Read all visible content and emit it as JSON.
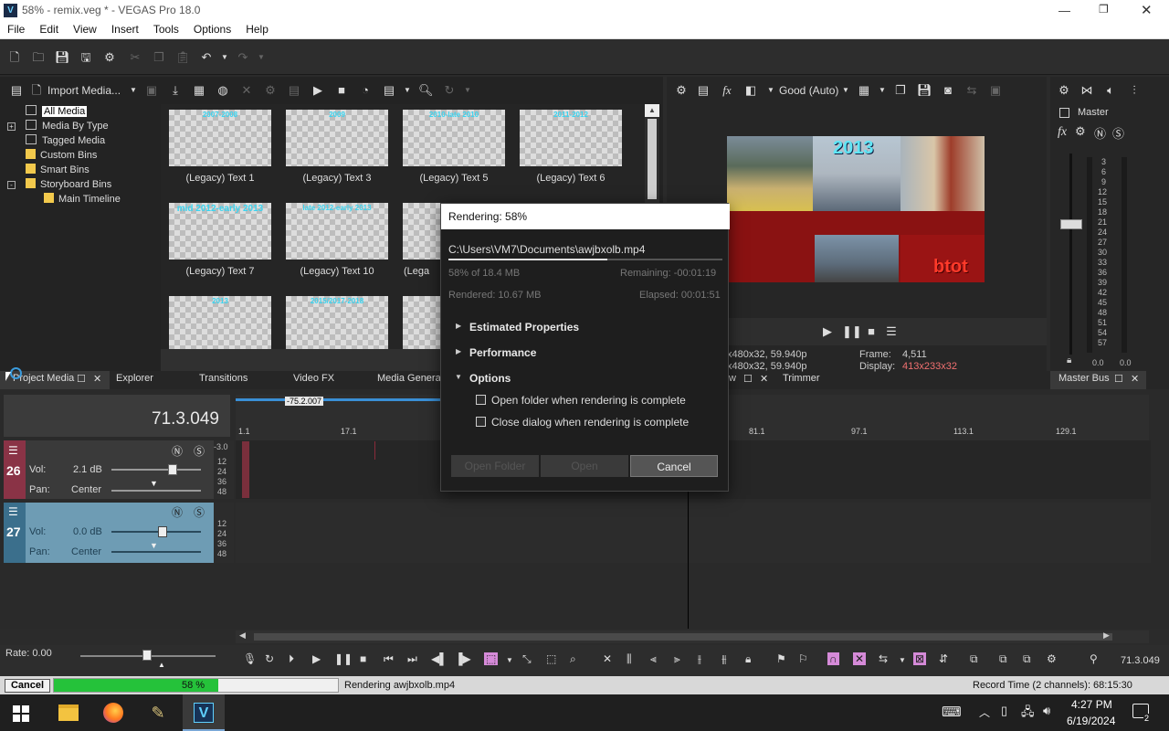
{
  "window": {
    "title": "58% - remix.veg * - VEGAS Pro 18.0"
  },
  "menu": [
    "File",
    "Edit",
    "View",
    "Insert",
    "Tools",
    "Options",
    "Help"
  ],
  "explorer": {
    "import_label": "Import Media...",
    "tree": [
      "All Media",
      "Media By Type",
      "Tagged Media",
      "Custom Bins",
      "Smart Bins",
      "Storyboard Bins",
      "Main Timeline"
    ],
    "thumbs": [
      {
        "overlay": "2007-2008",
        "caption": "(Legacy) Text 1"
      },
      {
        "overlay": "2009",
        "caption": "(Legacy) Text 3"
      },
      {
        "overlay": "2010-late 2010",
        "caption": "(Legacy) Text 5"
      },
      {
        "overlay": "2011-2012",
        "caption": "(Legacy) Text 6"
      },
      {
        "overlay": "mid 2012-early 2013",
        "caption": "(Legacy) Text 7"
      },
      {
        "overlay": "late 2012-early 2013",
        "caption": "(Legacy) Text 10"
      },
      {
        "overlay": "",
        "caption": "(Lega"
      },
      {
        "overlay": "2013",
        "caption": ""
      },
      {
        "overlay": "2015/2017-2018",
        "caption": ""
      },
      {
        "overlay": "",
        "caption": ""
      }
    ]
  },
  "tabs": {
    "project_media": "Project Media",
    "explorer": "Explorer",
    "transitions": "Transitions",
    "video_fx": "Video FX",
    "media_generators": "Media Generat",
    "w_fragment": "w",
    "trimmer": "Trimmer",
    "master_bus": "Master Bus"
  },
  "preview": {
    "quality": "Good (Auto)",
    "overlay_year": "2013",
    "overlay_tag": "btot",
    "info1": "x480x32, 59.940p",
    "info2": "x480x32, 59.940p",
    "frame_label": "Frame:",
    "frame_value": "4,511",
    "display_label": "Display:",
    "display_value": "413x233x32"
  },
  "master": {
    "label": "Master",
    "scale": [
      "3",
      "6",
      "9",
      "12",
      "15",
      "18",
      "21",
      "24",
      "27",
      "30",
      "33",
      "36",
      "39",
      "42",
      "45",
      "48",
      "51",
      "54",
      "57"
    ],
    "left_val": "0.0",
    "right_val": "0.0"
  },
  "timeline": {
    "time": "71.3.049",
    "cursor_label": "-75.2.007",
    "ruler": [
      "1.1",
      "17.1",
      "81.1",
      "97.1",
      "113.1",
      "129.1"
    ],
    "tracks": [
      {
        "number": "26",
        "vol_label": "Vol:",
        "vol_value": "2.1 dB",
        "pan_label": "Pan:",
        "pan_value": "Center",
        "meter": [
          "-3.0",
          "12",
          "24",
          "36",
          "48"
        ],
        "vol_level": 0.7
      },
      {
        "number": "27",
        "vol_label": "Vol:",
        "vol_value": "0.0 dB",
        "pan_label": "Pan:",
        "pan_value": "Center",
        "meter": [
          "12",
          "24",
          "36",
          "48"
        ],
        "vol_level": 0.58
      }
    ],
    "rate": "Rate: 0.00",
    "end_time": "71.3.049"
  },
  "dialog": {
    "title": "Rendering: 58%",
    "path": "C:\\Users\\VM7\\Documents\\awjbxolb.mp4",
    "progress": 0.58,
    "done": "58% of 18.4 MB",
    "remaining": "Remaining: -00:01:19",
    "rendered": "Rendered: 10.67 MB",
    "elapsed": "Elapsed: 00:01:51",
    "sections": [
      "Estimated Properties",
      "Performance",
      "Options"
    ],
    "opt1": "Open folder when rendering is complete",
    "opt2": "Close dialog when rendering is complete",
    "btn_folder": "Open Folder",
    "btn_open": "Open",
    "btn_cancel": "Cancel"
  },
  "status": {
    "cancel": "Cancel",
    "progress_text": "58 %",
    "progress": 0.58,
    "message": "Rendering awjbxolb.mp4",
    "record_time": "Record Time (2 channels): 68:15:30"
  },
  "taskbar": {
    "time": "4:27 PM",
    "date": "6/19/2024",
    "notif": "2"
  }
}
